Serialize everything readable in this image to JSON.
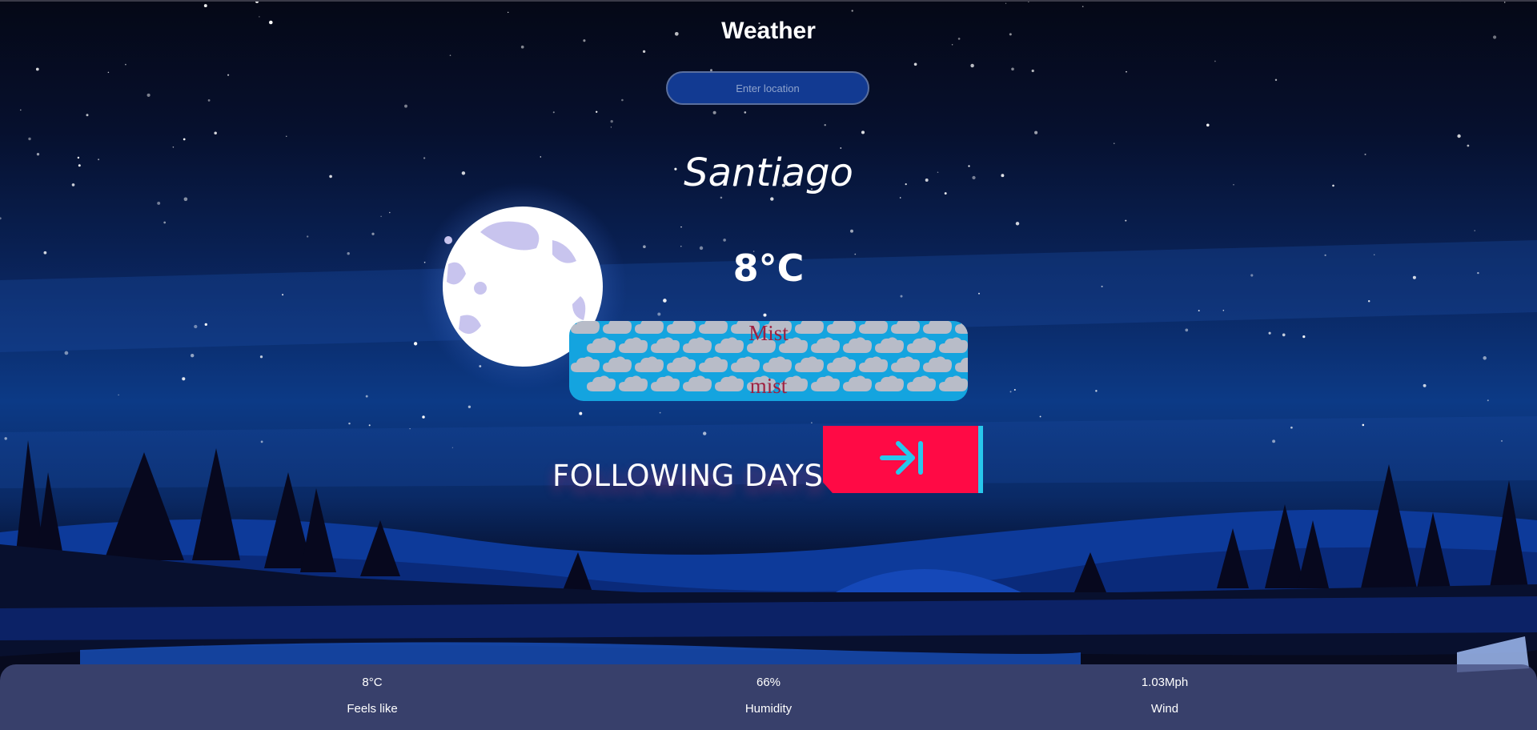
{
  "header": {
    "title": "Weather"
  },
  "search": {
    "placeholder": "Enter location",
    "value": ""
  },
  "weather": {
    "city": "Santiago",
    "temperature": "8°C",
    "condition_main": "Mist",
    "condition_description": "mist"
  },
  "forecast": {
    "label": "FOLLOWING DAYS",
    "button_icon": "arrow-right-to-line-icon"
  },
  "stats": {
    "feels_like": {
      "value": "8°C",
      "label": "Feels like"
    },
    "humidity": {
      "value": "66%",
      "label": "Humidity"
    },
    "wind": {
      "value": "1.03Mph",
      "label": "Wind"
    }
  },
  "colors": {
    "accent_button": "#ff0a45",
    "button_edge": "#28c8ec",
    "condition_box": "#14a4df",
    "condition_text": "#9e2040"
  }
}
